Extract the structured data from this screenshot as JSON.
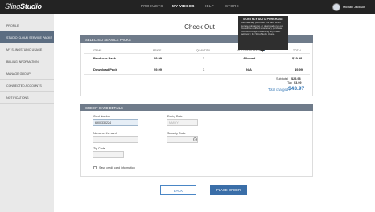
{
  "app": {
    "logo_light": "Sling",
    "logo_bold": "Studio",
    "username": "Michael Jackson"
  },
  "nav": [
    "PRODUCTS",
    "MY VIDEOS",
    "HELP",
    "STORE"
  ],
  "sidebar": [
    "PROFILE",
    "STUDIO CLOUD SERVICE PACKS",
    "MY SLINGSTUDIO USAGE",
    "BILLING INFORMATION",
    "MANAGE GROUP",
    "CONNECTED ACCOUNTS",
    "NOTIFICATIONS"
  ],
  "page_title": "Check Out",
  "tooltip": {
    "title": "MONTHLY AUTO PURCHASE",
    "body": "Automatically purchase this pack when storage, streaming, or downloads run out. You will be notified upon every purchase. You can change this setting anytime in Settings > My SlingStudio Usage."
  },
  "selected_packs": {
    "header": "SELECTED SERVICE PACKS",
    "columns": [
      "ITEMS",
      "PRICE",
      "QUANTITY",
      "AUTO PURCHASE",
      "TOTAL"
    ],
    "rows": [
      {
        "item": "Producer Pack",
        "price": "$9.99",
        "quantity": "2",
        "auto": "Allowed",
        "total": "$19.98"
      },
      {
        "item": "Download Pack",
        "price": "$9.99",
        "quantity": "1",
        "auto": "N/A",
        "total": "$9.99"
      }
    ],
    "subtotal_label": "Sub total",
    "subtotal": "$28.98",
    "tax_label": "Tax",
    "tax": "$3.99",
    "total_label": "Total charged",
    "total": "$43.97"
  },
  "credit_card": {
    "header": "CREDIT CARD DETAILS",
    "card_number_label": "Card Number",
    "card_number": "6900330224",
    "expiry_label": "Expiry Date",
    "expiry_placeholder": "MM/YY",
    "name_label": "Name on the card",
    "security_label": "Security Code",
    "zip_label": "Zip Code",
    "save_label": "Save credit card information"
  },
  "buttons": {
    "back": "BACK",
    "place_order": "PLACE ORDER"
  },
  "colors": {
    "topbar": "#232323",
    "sidebar_active": "#5c6d81",
    "panel_header": "#6f7b8a",
    "accent_blue": "#3477b6",
    "primary_button": "#3a6ea8"
  }
}
